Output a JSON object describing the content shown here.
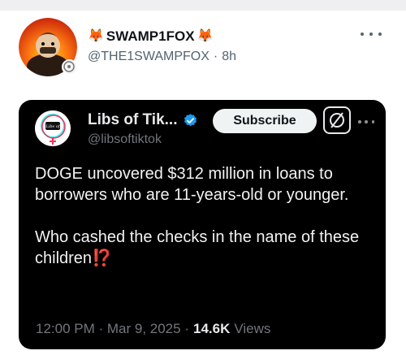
{
  "post": {
    "author_name": "SWAMP1FOX",
    "author_emoji_left": "🦊",
    "author_emoji_right": "🦊",
    "handle": "@THE1SWAMPFOX",
    "separator": "·",
    "time": "8h",
    "more_icon": "more-horizontal-icon"
  },
  "quoted": {
    "name": "Libs of Tik...",
    "handle": "@libsoftiktok",
    "subscribe_label": "Subscribe",
    "grok_icon": "grok-icon",
    "avatar_text": "Libs of TikTok",
    "paragraphs": [
      "DOGE uncovered $312 million in loans to borrowers who are 11-years-old or younger.",
      "Who cashed the checks in the name of these children"
    ],
    "alarm": "⁉️",
    "timestamp": "12:00 PM · Mar 9, 2025 ·",
    "views_count": "14.6K",
    "views_label": "Views"
  },
  "colors": {
    "card_bg": "#000000",
    "verified_blue": "#1d9bf0",
    "muted_gray": "#71767b",
    "alarm_red": "#f4212e"
  }
}
